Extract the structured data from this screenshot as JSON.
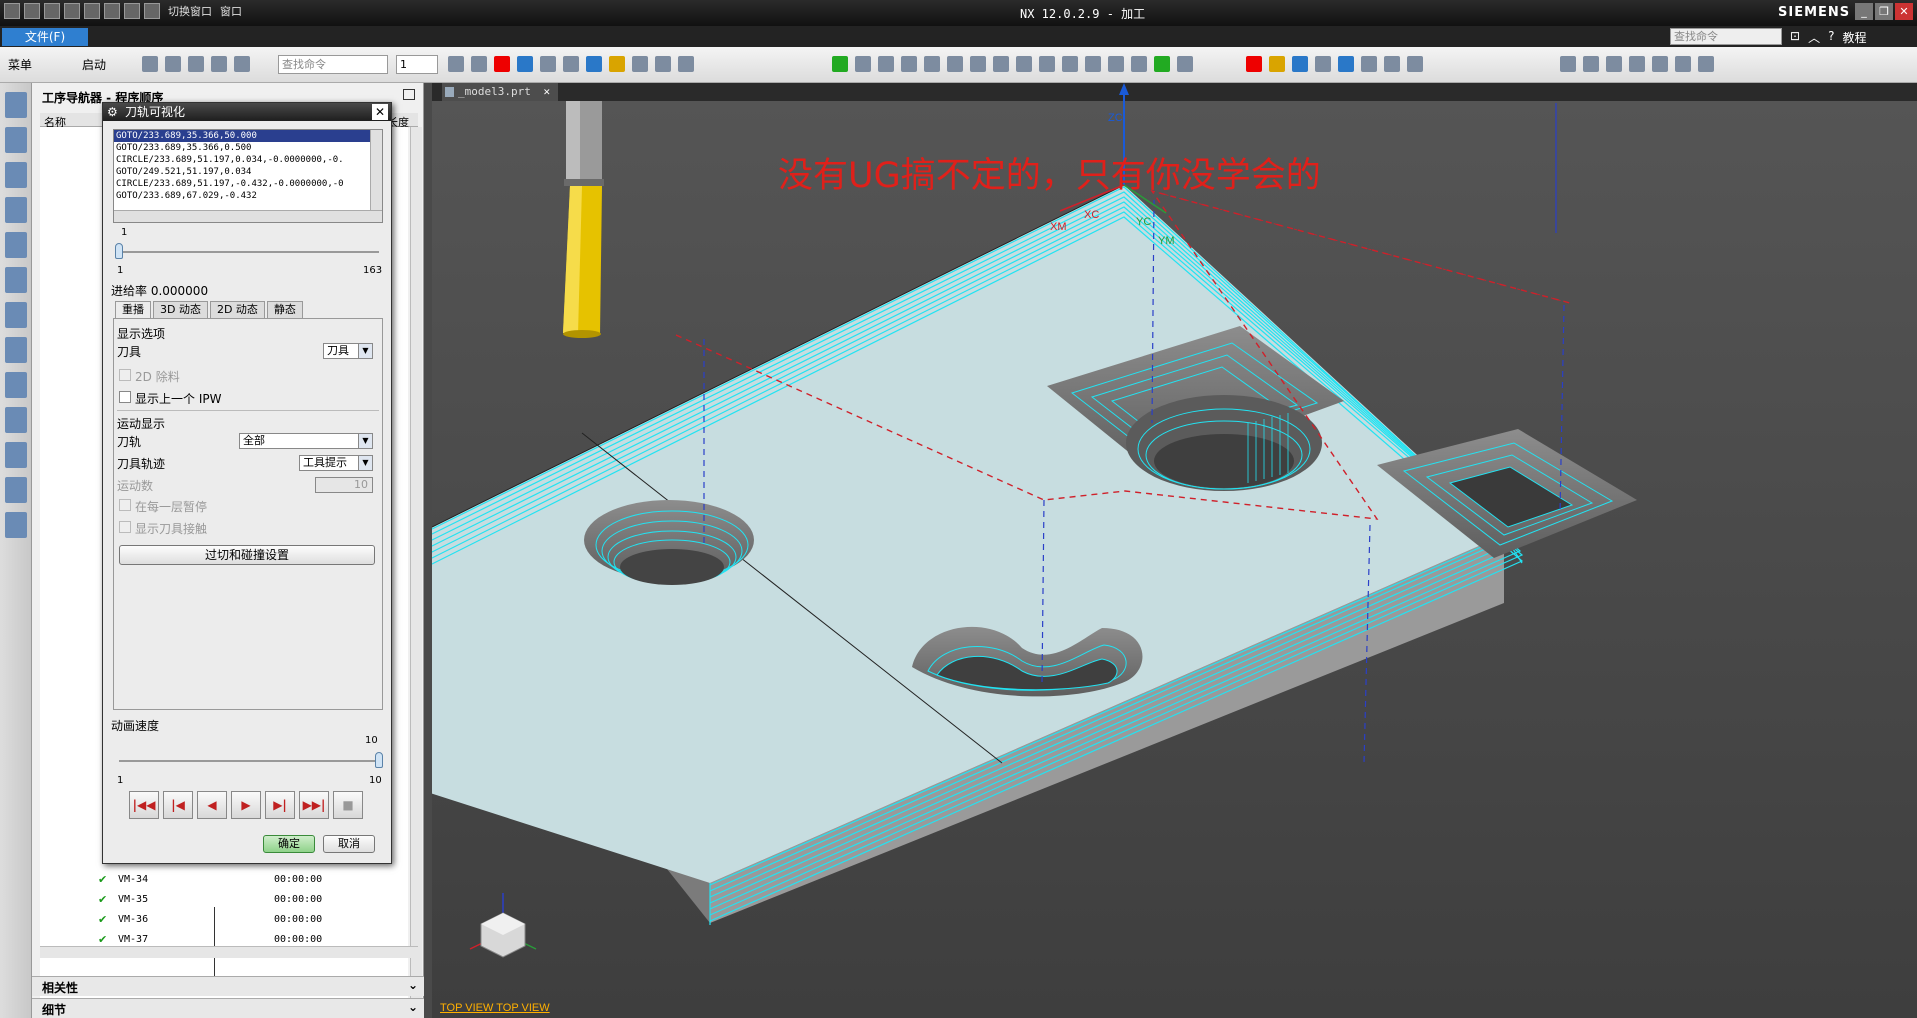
{
  "app": {
    "title": "NX 12.0.2.9 - 加工",
    "brand": "SIEMENS",
    "qa_window_switch": "切换窗口",
    "qa_window": "窗口",
    "search_placeholder": "查找命令",
    "help_link": "教程"
  },
  "menubar": {
    "file_label": "文件(F)"
  },
  "toolbar": {
    "menu_label": "菜单",
    "start_label": "启动",
    "find_placeholder": "查找命令",
    "filter_value": "1"
  },
  "navigator": {
    "title": "工序导航器 - 程序顺序",
    "col_name": "名称",
    "col_tool_length": "具长度",
    "operations": [
      {
        "name": "VM-34",
        "time": "00:00:00"
      },
      {
        "name": "VM-35",
        "time": "00:00:00"
      },
      {
        "name": "VM-36",
        "time": "00:00:00"
      },
      {
        "name": "VM-37",
        "time": "00:00:00"
      }
    ],
    "sections": {
      "dependencies": "相关性",
      "details": "细节"
    }
  },
  "dialog": {
    "title": "刀轨可视化",
    "cl_lines": [
      "GOTO/233.689,35.366,50.000",
      "GOTO/233.689,35.366,0.500",
      "CIRCLE/233.689,51.197,0.034,-0.0000000,-0.",
      "GOTO/249.521,51.197,0.034",
      "CIRCLE/233.689,51.197,-0.432,-0.0000000,-0",
      "GOTO/233.689,67.029,-0.432"
    ],
    "slider": {
      "value": "1",
      "min": "1",
      "max": "163",
      "position": 1
    },
    "feedrate_label": "进给率 0.000000",
    "tabs": [
      "重播",
      "3D 动态",
      "2D 动态",
      "静态"
    ],
    "display_options_label": "显示选项",
    "tool_label": "刀具",
    "tool_value": "刀具",
    "material_2d_label": "2D 除料",
    "show_prev_ipw_label": "显示上一个 IPW",
    "motion_display_label": "运动显示",
    "toolpath_label": "刀轨",
    "toolpath_value": "全部",
    "tool_trace_label": "刀具轨迹",
    "tool_trace_value": "工具提示",
    "motion_count_label": "运动数",
    "motion_count_value": "10",
    "pause_each_layer_label": "在每一层暂停",
    "show_tool_contact_label": "显示刀具接触",
    "gouge_button": "过切和碰撞设置",
    "anim_speed_label": "动画速度",
    "anim_speed": {
      "value": "10",
      "min": "1",
      "max": "10",
      "position": 10
    },
    "ok_label": "确定",
    "cancel_label": "取消"
  },
  "viewport": {
    "tab_label": "_model3.prt",
    "banner_text": "没有UG搞不定的，只有你没学会的",
    "axis_labels": {
      "zc": "ZC",
      "xc": "XC",
      "yc": "YC",
      "xm": "XM",
      "ym": "YM"
    },
    "view_label": "TOP VIEW   TOP VIEW"
  },
  "colors": {
    "part_face": "#c7dde0",
    "toolpath": "#22e3f2",
    "rapid_path": "#d0202a",
    "tool_holder": "#9a9a9a",
    "tool_body": "#e6c200",
    "banner": "#e0201a"
  }
}
